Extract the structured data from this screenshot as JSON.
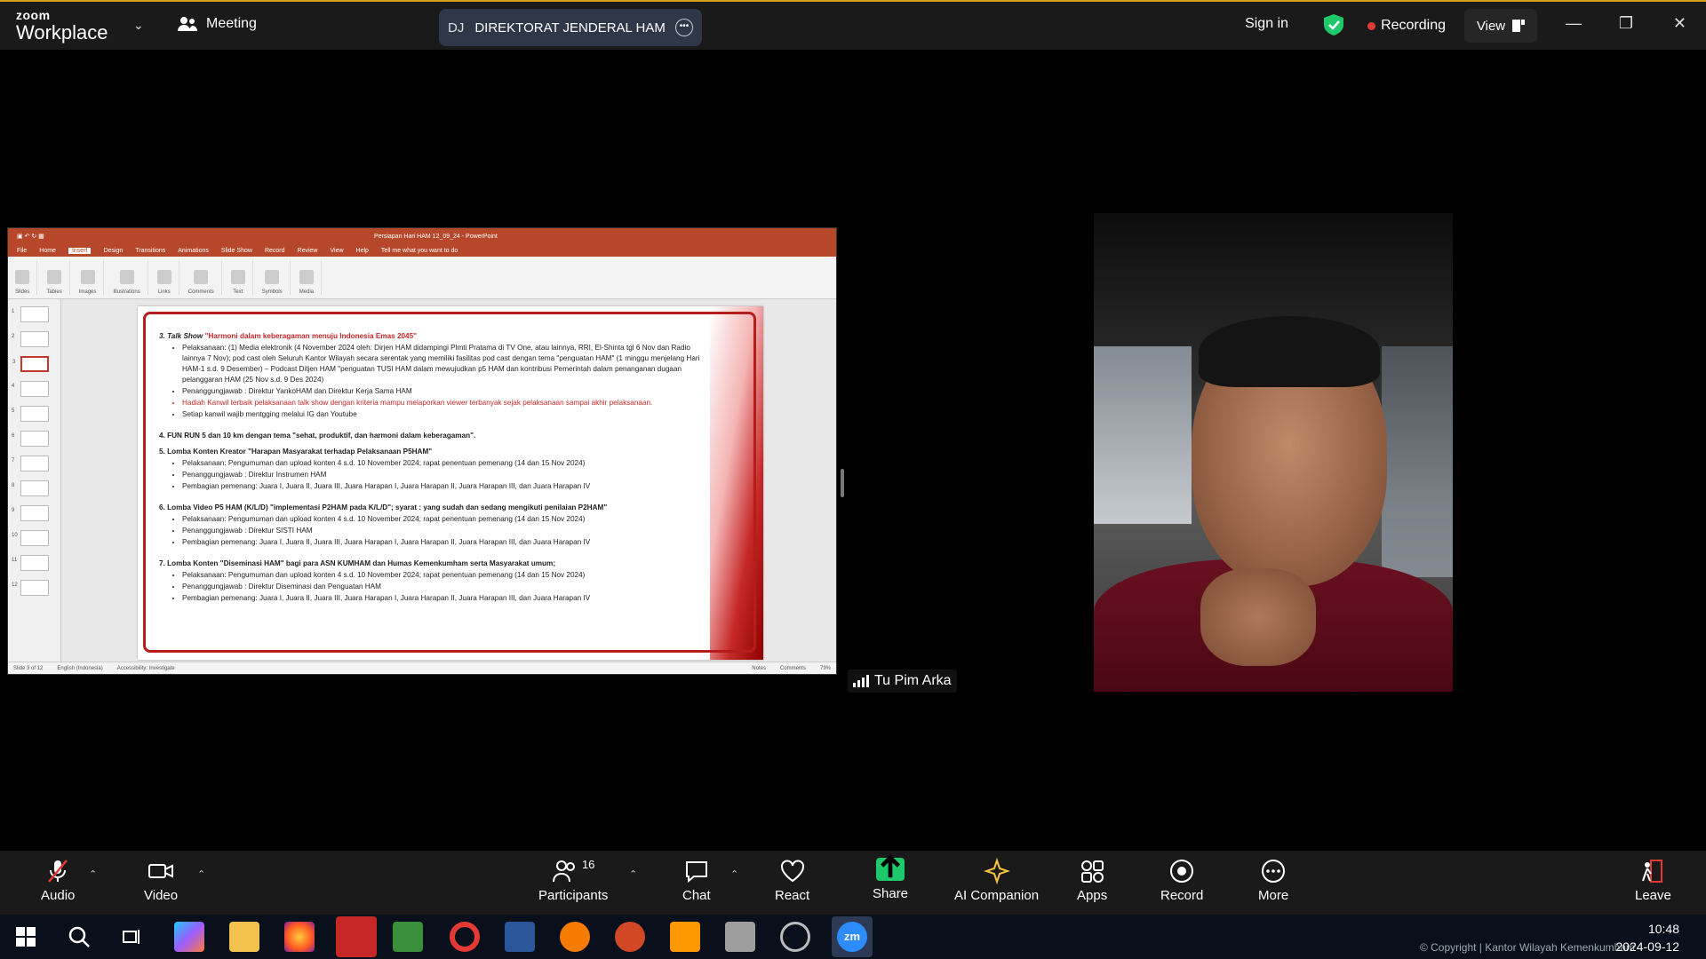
{
  "titlebar": {
    "brand_top": "zoom",
    "brand_bottom": "Workplace",
    "meeting_label": "Meeting",
    "meeting_initials": "DJ",
    "meeting_title": "DIREKTORAT JENDERAL HAM's s",
    "sign_in": "Sign in",
    "recording": "Recording",
    "view": "View"
  },
  "powerpoint": {
    "window_title": "Persiapan Hari HAM 12_09_24 - PowerPoint",
    "menu": [
      "File",
      "Home",
      "Insert",
      "Design",
      "Transitions",
      "Animations",
      "Slide Show",
      "Record",
      "Review",
      "View",
      "Help"
    ],
    "active_menu": "Insert",
    "tell_me": "Tell me what you want to do",
    "ribbon_groups": [
      "Slides",
      "Tables",
      "Images",
      "Illustrations",
      "Links",
      "Comments",
      "Text",
      "Symbols",
      "Media"
    ],
    "status_slide": "Slide 3 of 12",
    "status_lang": "English (Indonesia)",
    "status_access": "Accessibility: Investigate",
    "status_notes": "Notes",
    "status_comments": "Comments",
    "status_zoom": "79%"
  },
  "slide": {
    "s3_title": "3. Talk Show",
    "s3_theme": "\"Harmoni dalam keberagaman menuju Indonesia Emas 2045\"",
    "s3_b1": "Pelaksanaan: (1) Media elektronik (4 November 2024 oleh: Dirjen HAM didampingi Plmti Pratama di TV One, atau lainnya, RRI, El-Shinta tgl 6 Nov dan Radio lainnya 7 Nov); pod cast oleh Seluruh Kantor Wilayah secara serentak yang memiliki fasilitas pod cast dengan tema \"penguatan HAM\" (1 minggu menjelang Hari HAM-1 s.d. 9 Desember) – Podcast Ditjen HAM \"penguatan TUSI HAM dalam mewujudkan p5 HAM dan kontribusi Pemerintah dalam penanganan dugaan pelanggaran HAM (25 Nov s.d. 9 Des 2024)",
    "s3_b2": "Penanggungjawab : Direktur YankoHAM dan Direktur Kerja Sama HAM",
    "s3_b3": "Hadiah Kanwil terbaik pelaksanaan talk show dengan kriteria mampu melaporkan viewer terbanyak sejak pelaksanaan sampai akhir pelaksanaan.",
    "s3_b4": "Setiap kanwil wajib mentgging melalui IG dan Youtube",
    "s4": "4. FUN RUN 5 dan 10 km dengan tema \"sehat, produktif, dan harmoni dalam keberagaman\".",
    "s5_title": "5. Lomba Konten Kreator \"Harapan Masyarakat terhadap Pelaksanaan P5HAM\"",
    "s5_b1": "Pelaksanaan: Pengumuman dan upload konten 4 s.d. 10 November 2024; rapat penentuan pemenang (14 dan 15 Nov 2024)",
    "s5_b2": "Penanggungjawab : Direktur Instrumen HAM",
    "s5_b3": "Pembagian pemenang: Juara I, Juara II, Juara III, Juara Harapan I, Juara Harapan II, Juara Harapan III, dan Juara Harapan IV",
    "s6_title": "6. Lomba Video P5 HAM (K/L/D) \"implementasi P2HAM pada K/L/D\"; syarat : yang sudah dan sedang mengikuti penilaian P2HAM\"",
    "s6_b1": "Pelaksanaan: Pengumuman dan upload konten 4 s.d. 10 November 2024; rapat penentuan pemenang (14 dan 15 Nov 2024)",
    "s6_b2": "Penanggungjawab : Direktur SISTI HAM",
    "s6_b3": "Pembagian pemenang: Juara I, Juara II, Juara III, Juara Harapan I, Juara Harapan II, Juara Harapan III, dan Juara Harapan IV",
    "s7_title": "7. Lomba Konten \"Diseminasi HAM\" bagi para ASN KUMHAM dan Humas Kemenkumham serta Masyarakat umum;",
    "s7_b1": "Pelaksanaan: Pengumuman dan upload konten 4 s.d. 10 November 2024; rapat penentuan pemenang (14 dan 15 Nov 2024)",
    "s7_b2": "Penanggungjawab : Direktur Diseminasi dan Penguatan HAM",
    "s7_b3": "Pembagian pemenang: Juara I, Juara II, Juara III, Juara Harapan I, Juara Harapan II, Juara Harapan III, dan Juara Harapan IV"
  },
  "thumbnails": [
    "1",
    "2",
    "3",
    "4",
    "5",
    "6",
    "7",
    "8",
    "9",
    "10",
    "11",
    "12"
  ],
  "participant": {
    "name": "Tu Pim Arka"
  },
  "toolbar": {
    "audio": "Audio",
    "video": "Video",
    "participants": "Participants",
    "participants_count": "16",
    "chat": "Chat",
    "react": "React",
    "share": "Share",
    "ai_companion": "AI Companion",
    "apps": "Apps",
    "record": "Record",
    "more": "More",
    "leave": "Leave"
  },
  "taskbar": {
    "time": "10:48",
    "date": "2024-09-12",
    "copyright": "© Copyright | Kantor Wilayah Kemenkumham"
  },
  "colors": {
    "accent_red": "#c62828",
    "share_green": "#1ec96c",
    "record_dot": "#e53935",
    "titlebar_border": "#d4a017"
  }
}
